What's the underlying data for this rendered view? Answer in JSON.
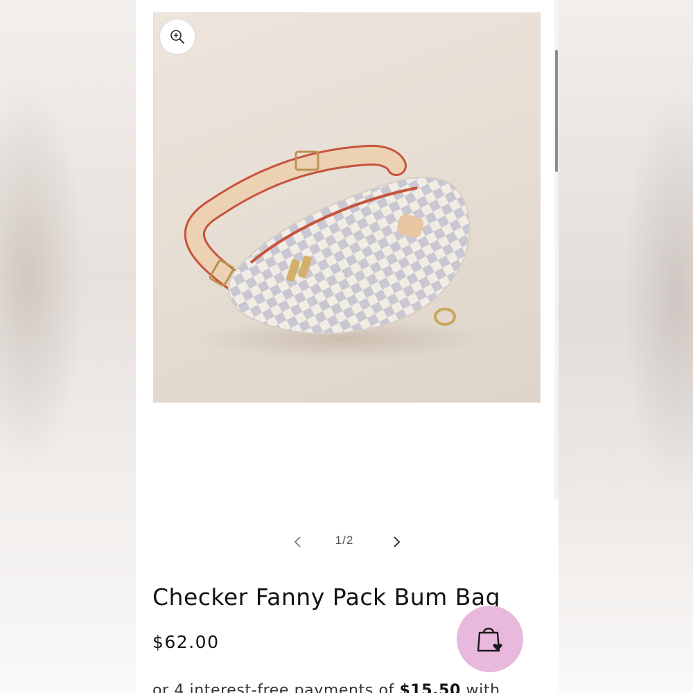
{
  "gallery": {
    "counter": "1/2",
    "image_alt": "Checker Fanny Pack Bum Bag",
    "zoom_icon": "zoom-in-icon",
    "prev_icon": "chevron-left-icon",
    "next_icon": "chevron-right-icon"
  },
  "product": {
    "title": "Checker Fanny Pack Bum Bag",
    "price": "$62.00",
    "installments_prefix": "or 4 interest-free payments of ",
    "installments_amount": "$15.50",
    "installments_suffix": " with"
  },
  "floating_button": {
    "icon": "shopping-bag-heart-icon",
    "color": "#e8b8dd"
  },
  "colors": {
    "background": "#ffffff",
    "text": "#121212",
    "accent": "#e8b8dd"
  }
}
